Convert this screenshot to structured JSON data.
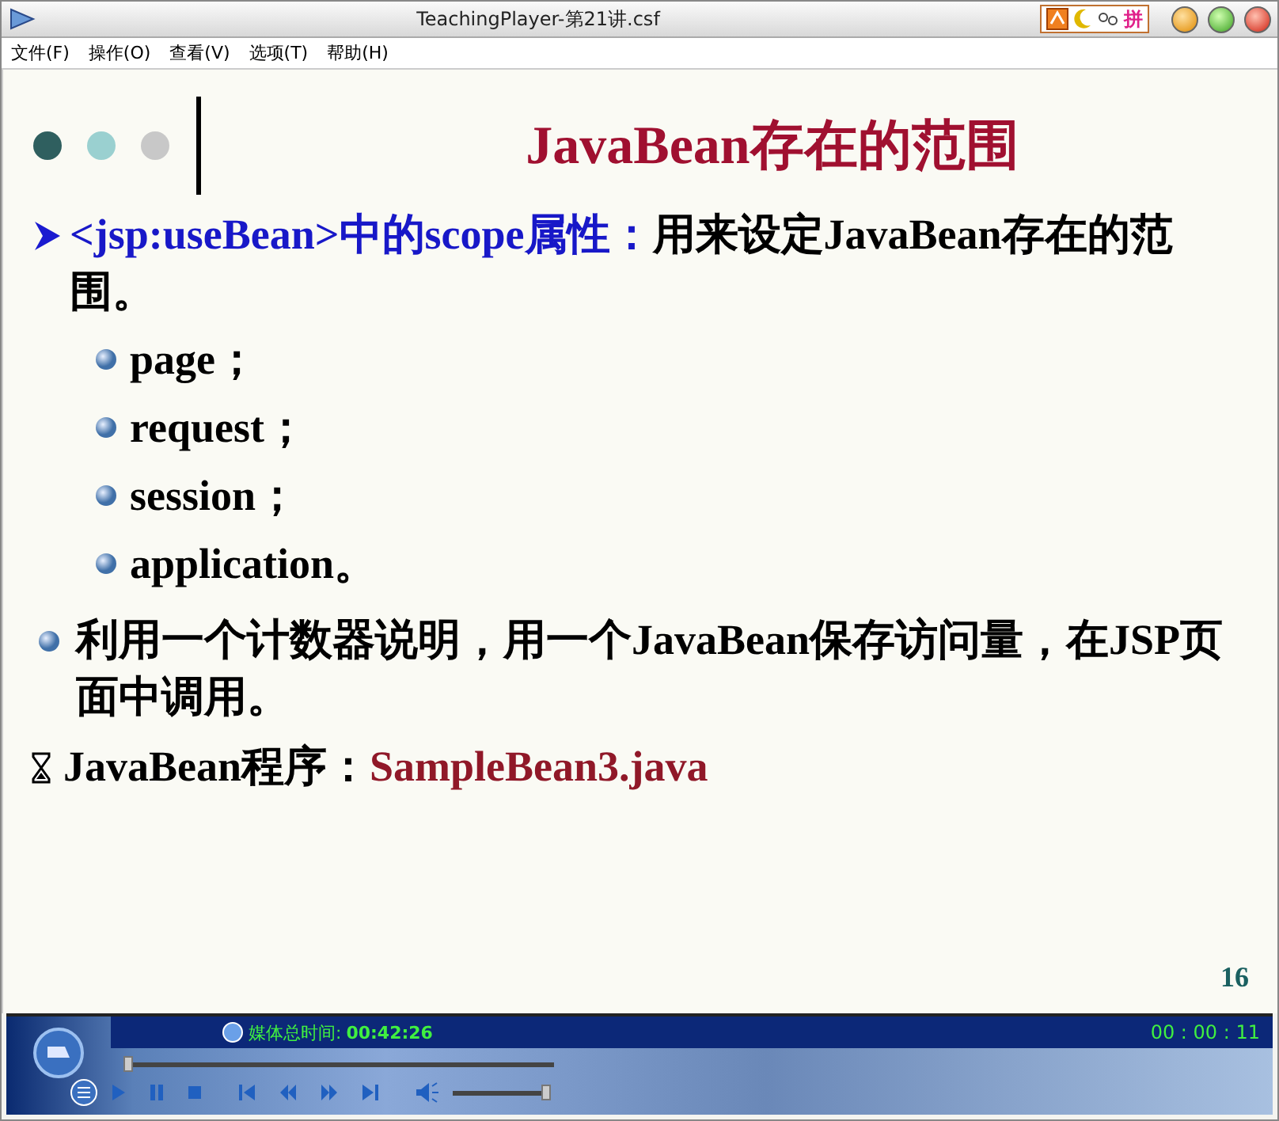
{
  "window": {
    "title": "TeachingPlayer-第21讲.csf",
    "ime_label": "拼"
  },
  "menu": [
    {
      "label": "文件(F)"
    },
    {
      "label": "操作(O)"
    },
    {
      "label": "查看(V)"
    },
    {
      "label": "选项(T)"
    },
    {
      "label": "帮助(H)"
    }
  ],
  "slide": {
    "title": "JavaBean存在的范围",
    "page_number": "16",
    "items": [
      {
        "kind": "arrow",
        "lead": "<jsp:useBean>中的scope属性：",
        "text": "用来设定JavaBean存在的范围。"
      },
      {
        "kind": "subdot",
        "text": "page；"
      },
      {
        "kind": "subdot",
        "text": "request；"
      },
      {
        "kind": "subdot",
        "text": "session；"
      },
      {
        "kind": "subdot",
        "text": "application。"
      },
      {
        "kind": "dot",
        "text": "利用一个计数器说明，用一个JavaBean保存访问量，在JSP页面中调用。"
      },
      {
        "kind": "cursor",
        "text": "JavaBean程序：",
        "tail": "SampleBean3.java"
      }
    ]
  },
  "player": {
    "total_label": "媒体总时间:",
    "total_time": "00:42:26",
    "current_time": "00 : 00 : 11",
    "progress": {
      "level": 0.0
    },
    "volume": {
      "level": 1.0
    }
  }
}
